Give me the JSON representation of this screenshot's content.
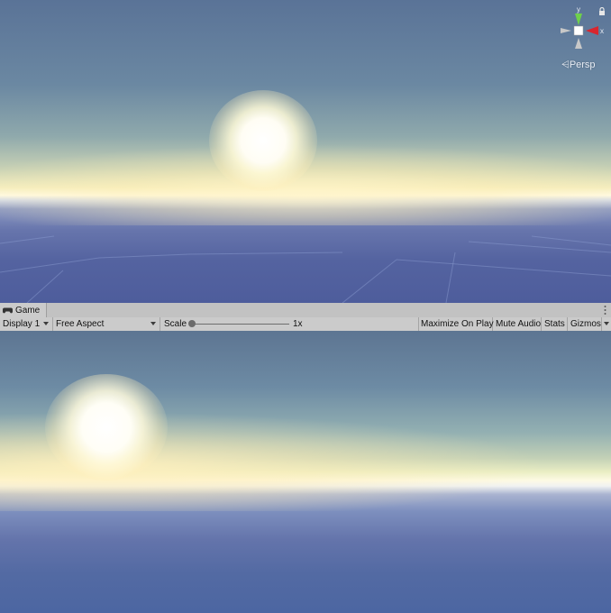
{
  "scene_view": {
    "gizmo": {
      "y_axis_label": "y",
      "x_axis_label": "x",
      "projection_label": "Persp",
      "colors": {
        "y_axis": "#6fd14a",
        "x_axis": "#d9262e",
        "neutral": "#c8c8c8"
      }
    }
  },
  "game_view": {
    "tab_label": "Game",
    "toolbar": {
      "display_value": "Display 1",
      "aspect_value": "Free Aspect",
      "scale_label": "Scale",
      "scale_value": "1x",
      "scale_level": 0.0,
      "maximize_label": "Maximize On Play",
      "mute_label": "Mute Audio",
      "stats_label": "Stats",
      "gizmos_label": "Gizmos"
    }
  }
}
